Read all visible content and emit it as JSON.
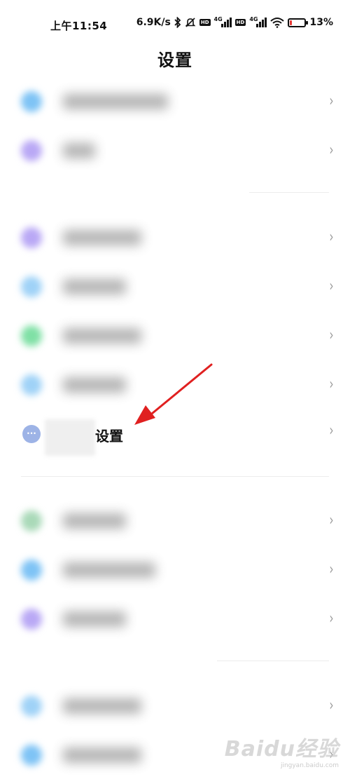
{
  "status_bar": {
    "time": "上午11:54",
    "net_speed": "6.9K/s",
    "battery_percent": "13%",
    "battery_level": 0.13,
    "icons": [
      "bluetooth-icon",
      "mute-icon",
      "hd-icon",
      "signal-4g-icon",
      "hd-icon",
      "signal-4g-icon",
      "wifi-icon",
      "battery-icon"
    ]
  },
  "header": {
    "title": "设置"
  },
  "list": {
    "blurred_icon_colors": [
      "#7ec3f5",
      "#b9a8f5",
      "#b9a8f5",
      "#9fd2f7",
      "#7fe0a5",
      "#9fd2f7",
      "#a9d9b8",
      "#7ec3f5",
      "#b9a8f5",
      "#9fd2f7",
      "#7ec3f5"
    ],
    "highlight_item": {
      "icon": "more-dots-icon",
      "icon_glyph": "···",
      "label": "设置"
    }
  },
  "colors": {
    "arrow": "#e02020",
    "chevron": "#9a9a9a",
    "highlight_icon": "#9db3e6"
  },
  "watermark": {
    "text": "Baidu经验",
    "subtext": "jingyan.baidu.com"
  }
}
